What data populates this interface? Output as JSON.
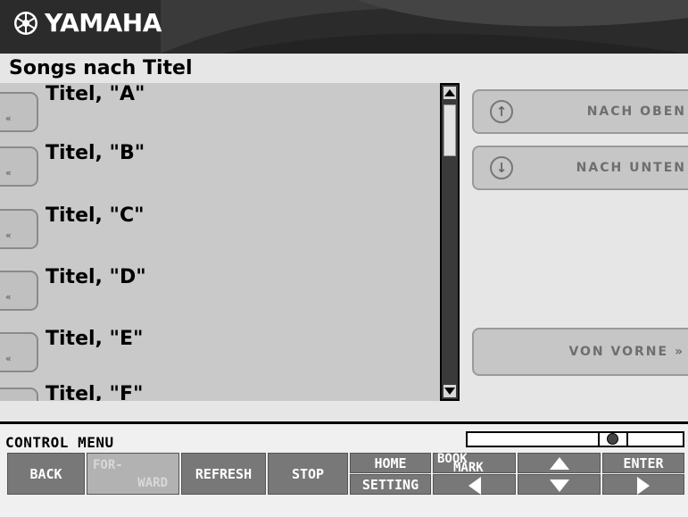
{
  "header": {
    "brand": "YAMAHA",
    "logo_icon": "tuning-forks-emblem-icon"
  },
  "page": {
    "title": "Songs nach Titel"
  },
  "list": {
    "items": [
      {
        "label": "Titel, \"A\""
      },
      {
        "label": "Titel, \"B\""
      },
      {
        "label": "Titel, \"C\""
      },
      {
        "label": "Titel, \"D\""
      },
      {
        "label": "Titel, \"E\""
      },
      {
        "label": "Titel, \"F\""
      }
    ],
    "tab_glyph": "«"
  },
  "nav_buttons": {
    "up": {
      "label": "NACH OBEN",
      "icon": "↑"
    },
    "down": {
      "label": "NACH UNTEN",
      "icon": "↓"
    },
    "restart": {
      "label": "VON VORNE »"
    }
  },
  "control_menu": {
    "title": "CONTROL MENU",
    "back": "BACK",
    "forward_line1": "FOR-",
    "forward_line2": "WARD",
    "refresh": "REFRESH",
    "stop": "STOP",
    "home": "HOME",
    "setting": "SETTING",
    "bookmark_line1": "BOOK",
    "bookmark_line2": "MARK",
    "enter": "ENTER"
  }
}
